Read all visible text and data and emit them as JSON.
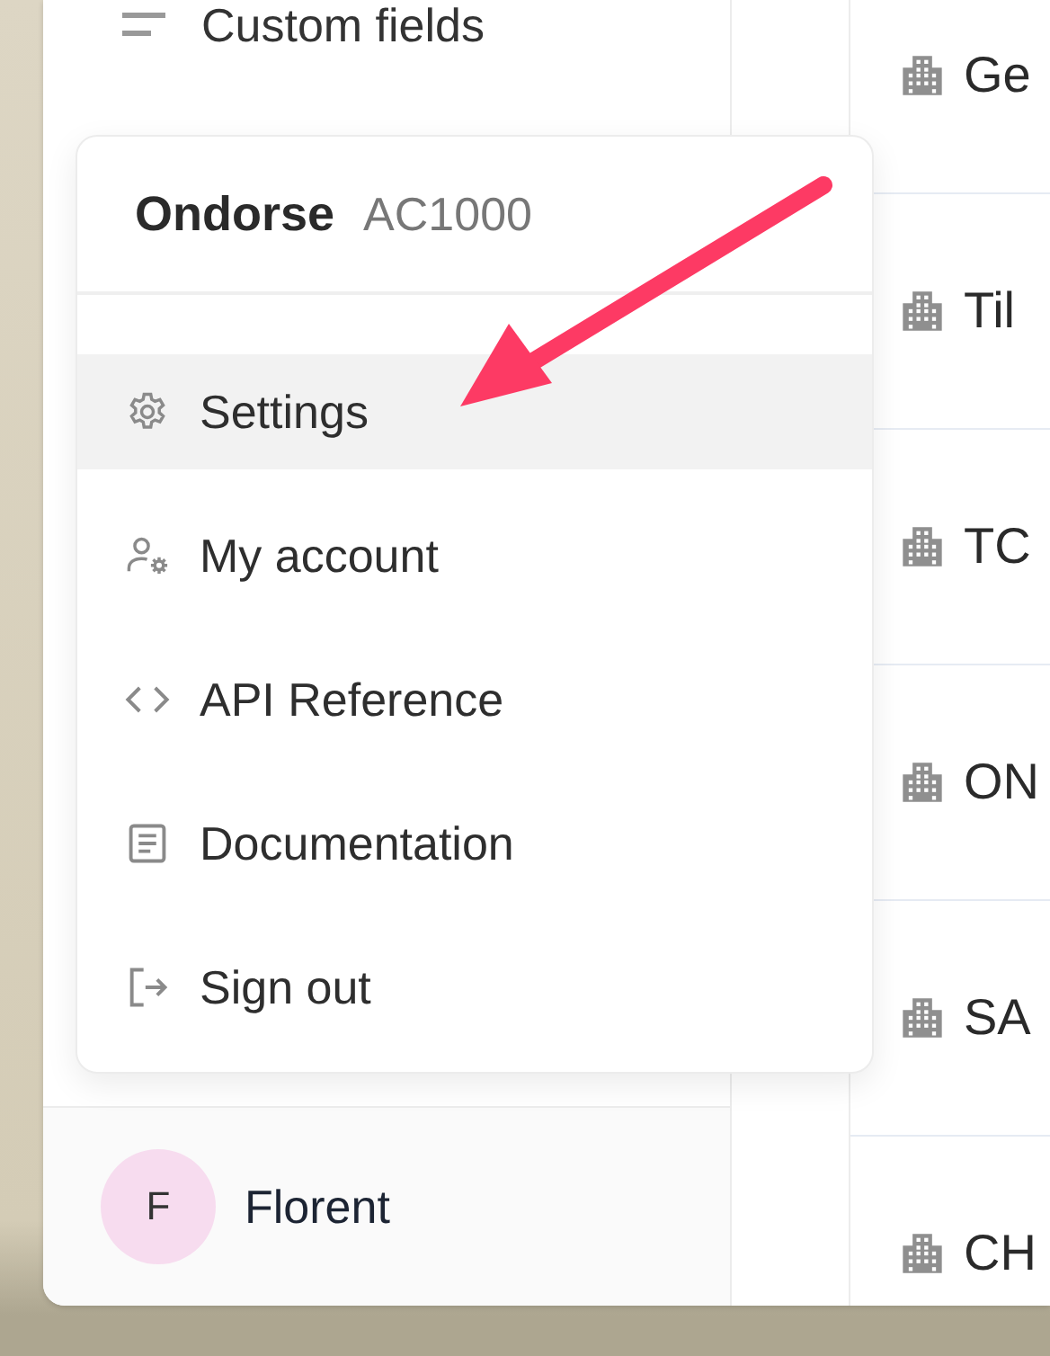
{
  "sidebar": {
    "items": [
      {
        "label": "Custom fields"
      }
    ],
    "user": {
      "initial": "F",
      "name": "Florent"
    }
  },
  "list": {
    "rows": [
      {
        "label": "Ge"
      },
      {
        "label": "Til"
      },
      {
        "label": "TC"
      },
      {
        "label": "ON"
      },
      {
        "label": "SA"
      },
      {
        "label": "CH"
      }
    ]
  },
  "menu": {
    "org": "Ondorse",
    "code": "AC1000",
    "items": [
      {
        "kind": "settings",
        "label": "Settings",
        "selected": true
      },
      {
        "kind": "account",
        "label": "My account",
        "selected": false
      },
      {
        "kind": "code",
        "label": "API Reference",
        "selected": false
      },
      {
        "kind": "document",
        "label": "Documentation",
        "selected": false
      },
      {
        "kind": "signout",
        "label": "Sign out",
        "selected": false
      }
    ]
  }
}
